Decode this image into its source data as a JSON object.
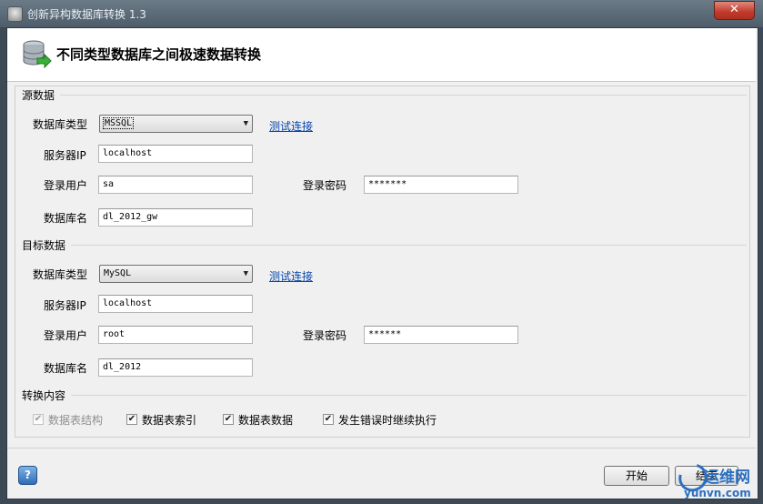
{
  "window": {
    "title": "创新异构数据库转换 1.3",
    "close_label": "✕"
  },
  "header": {
    "title": "不同类型数据库之间极速数据转换"
  },
  "source": {
    "section_label": "源数据",
    "db_type_label": "数据库类型",
    "db_type_value": "MSSQL",
    "test_link": "测试连接",
    "server_label": "服务器IP",
    "server_value": "localhost",
    "user_label": "登录用户",
    "user_value": "sa",
    "password_label": "登录密码",
    "password_value": "*******",
    "dbname_label": "数据库名",
    "dbname_value": "dl_2012_gw"
  },
  "target": {
    "section_label": "目标数据",
    "db_type_label": "数据库类型",
    "db_type_value": "MySQL",
    "test_link": "测试连接",
    "server_label": "服务器IP",
    "server_value": "localhost",
    "user_label": "登录用户",
    "user_value": "root",
    "password_label": "登录密码",
    "password_value": "******",
    "dbname_label": "数据库名",
    "dbname_value": "dl_2012"
  },
  "conversion": {
    "section_label": "转换内容",
    "options": [
      {
        "label": "数据表结构",
        "checked": true,
        "enabled": false
      },
      {
        "label": "数据表索引",
        "checked": true,
        "enabled": true
      },
      {
        "label": "数据表数据",
        "checked": true,
        "enabled": true
      },
      {
        "label": "发生错误时继续执行",
        "checked": true,
        "enabled": true
      }
    ]
  },
  "footer": {
    "help_label": "?",
    "start_label": "开始",
    "end_label": "结束"
  },
  "watermark": {
    "name": "运维网",
    "url": "yunvn.com"
  },
  "icons": {
    "app": "app-icon",
    "header": "database-arrow-icon",
    "help": "help-icon",
    "dropdown": "chevron-down-icon",
    "check": "checkmark-icon"
  }
}
